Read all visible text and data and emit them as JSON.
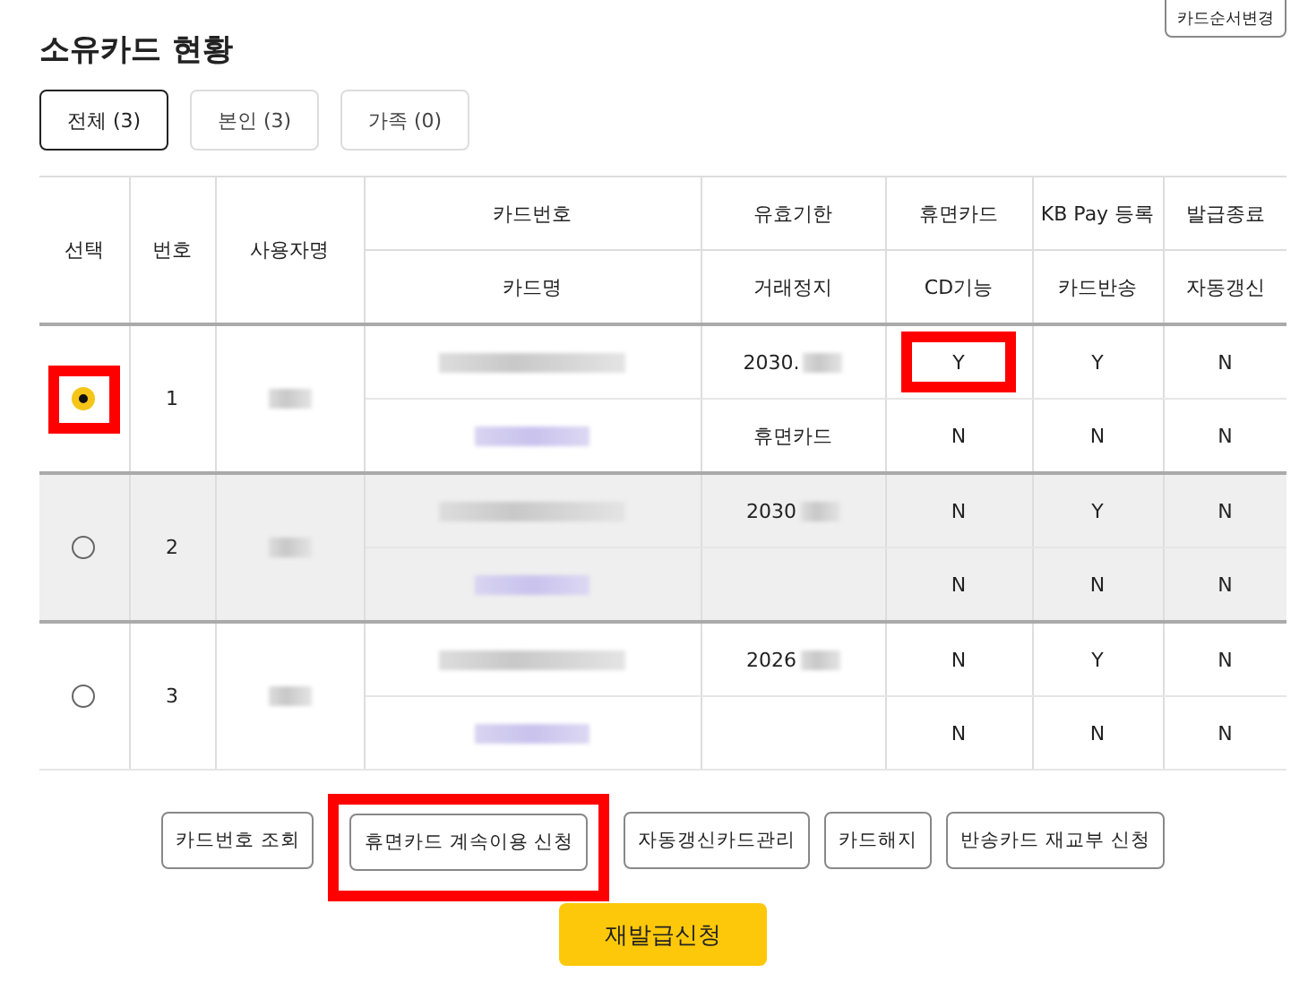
{
  "title": "소유카드 현황",
  "order_button": "카드순서변경",
  "tabs": [
    {
      "label": "전체 (3)",
      "selected": true
    },
    {
      "label": "본인 (3)",
      "selected": false
    },
    {
      "label": "가족 (0)",
      "selected": false
    }
  ],
  "table": {
    "header_top": [
      "선택",
      "번호",
      "사용자명",
      "카드번호",
      "유효기한",
      "휴면카드",
      "KB Pay 등록",
      "발급종료"
    ],
    "header_bottom": [
      "카드명",
      "거래정지",
      "CD기능",
      "카드반송",
      "자동갱신"
    ],
    "rows": [
      {
        "selected": true,
        "annotated_select": true,
        "hovered": false,
        "number": "1",
        "user_masked": true,
        "card_number_masked": true,
        "card_name_masked": true,
        "expiry": "2030.",
        "expiry_masked": true,
        "suspended": "휴면카드",
        "dormant": "Y",
        "annotated_dormant": true,
        "kbpay": "Y",
        "issue_end": "N",
        "cd": "N",
        "returned": "N",
        "auto_renew": "N"
      },
      {
        "selected": false,
        "annotated_select": false,
        "hovered": true,
        "number": "2",
        "user_masked": true,
        "card_number_masked": true,
        "card_name_masked": true,
        "expiry": "2030",
        "expiry_masked": true,
        "dormant": "N",
        "annotated_dormant": false,
        "kbpay": "Y",
        "issue_end": "N",
        "cd": "N",
        "returned": "N",
        "auto_renew": "N"
      },
      {
        "selected": false,
        "annotated_select": false,
        "hovered": false,
        "number": "3",
        "user_masked": true,
        "card_number_masked": true,
        "card_name_masked": true,
        "expiry": "2026",
        "expiry_masked": true,
        "dormant": "N",
        "annotated_dormant": false,
        "kbpay": "Y",
        "issue_end": "N",
        "cd": "N",
        "returned": "N",
        "auto_renew": "N"
      }
    ]
  },
  "actions": [
    {
      "label": "카드번호 조회",
      "annotated": false
    },
    {
      "label": "휴면카드 계속이용 신청",
      "annotated": true
    },
    {
      "label": "자동갱신카드관리",
      "annotated": false
    },
    {
      "label": "카드해지",
      "annotated": false
    },
    {
      "label": "반송카드 재교부 신청",
      "annotated": false
    }
  ],
  "primary_button": "재발급신청"
}
